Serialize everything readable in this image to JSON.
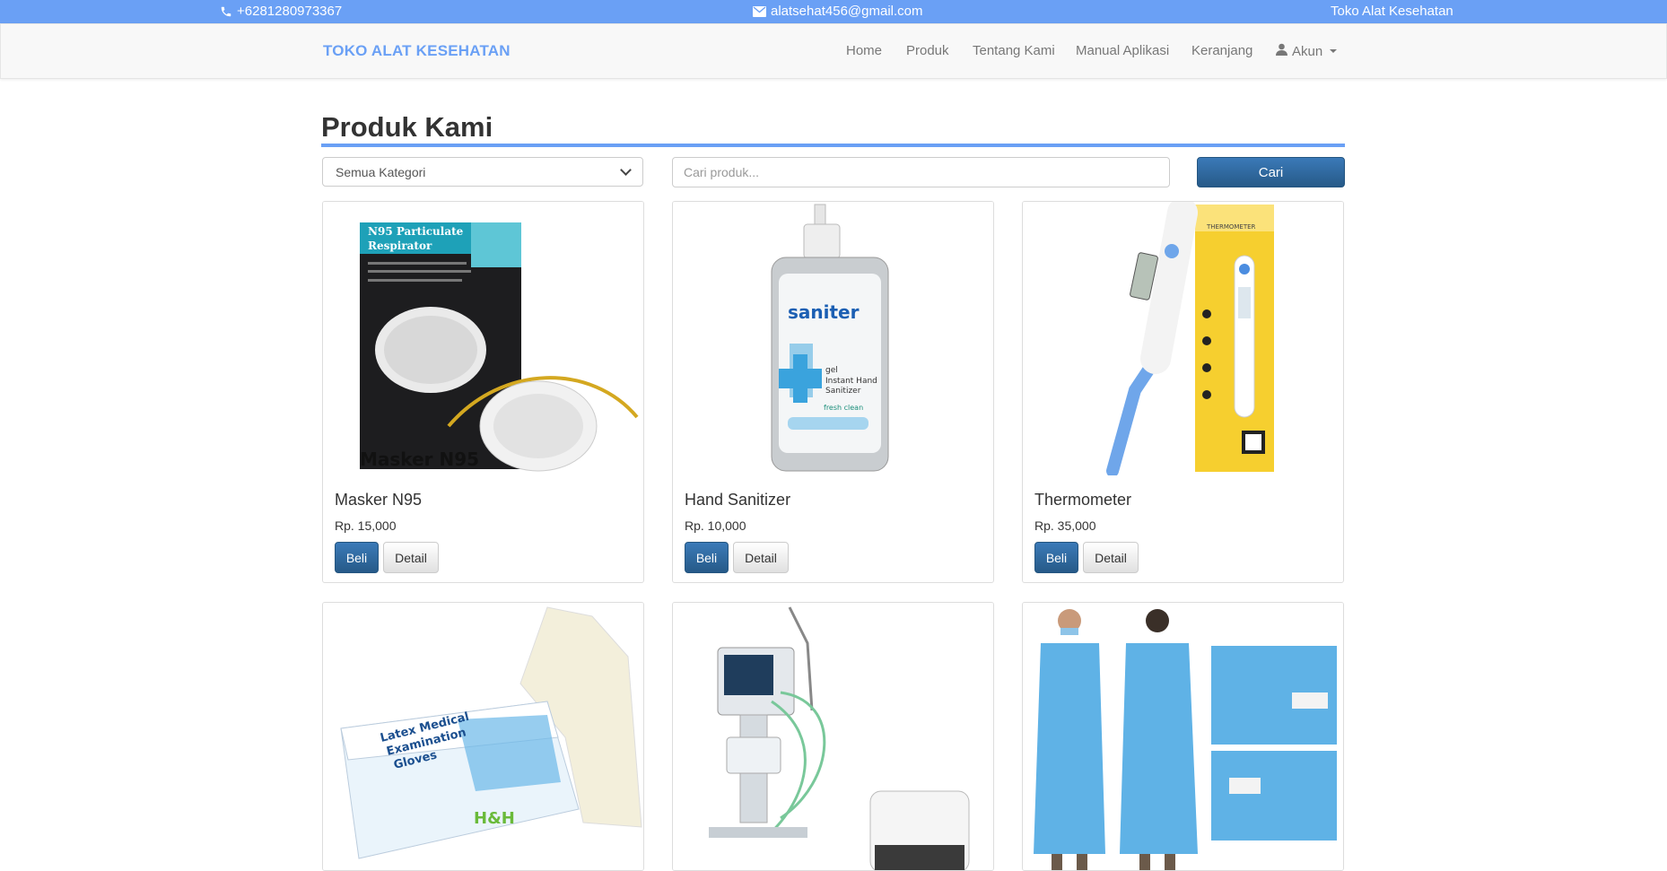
{
  "topbar": {
    "phone": "+6281280973367",
    "email": "alatsehat456@gmail.com",
    "store": "Toko Alat Kesehatan"
  },
  "navbar": {
    "brand": "TOKO ALAT KESEHATAN",
    "items": [
      "Home",
      "Produk",
      "Tentang Kami",
      "Manual Aplikasi",
      "Keranjang"
    ],
    "account": "Akun"
  },
  "main": {
    "title": "Produk Kami",
    "category_select": "Semua Kategori",
    "search_placeholder": "Cari produk...",
    "search_button": "Cari"
  },
  "products": [
    {
      "name": "Masker N95",
      "price": "Rp. 15,000",
      "buy": "Beli",
      "detail": "Detail",
      "image_text": [
        "N95 Particulate",
        "Respirator",
        "Masker N95"
      ]
    },
    {
      "name": "Hand Sanitizer",
      "price": "Rp. 10,000",
      "buy": "Beli",
      "detail": "Detail",
      "image_text": [
        "saniter",
        "gel",
        "Instant Hand",
        "Sanitizer",
        "fresh clean"
      ]
    },
    {
      "name": "Thermometer",
      "price": "Rp. 35,000",
      "buy": "Beli",
      "detail": "Detail",
      "image_text": [
        "THERMOMETER"
      ]
    },
    {
      "image_text": [
        "Latex Medical",
        "Examination",
        "Gloves",
        "H&H"
      ]
    },
    {},
    {}
  ],
  "colors": {
    "accent": "#6aa0f5",
    "primary_button": "#265a88"
  }
}
